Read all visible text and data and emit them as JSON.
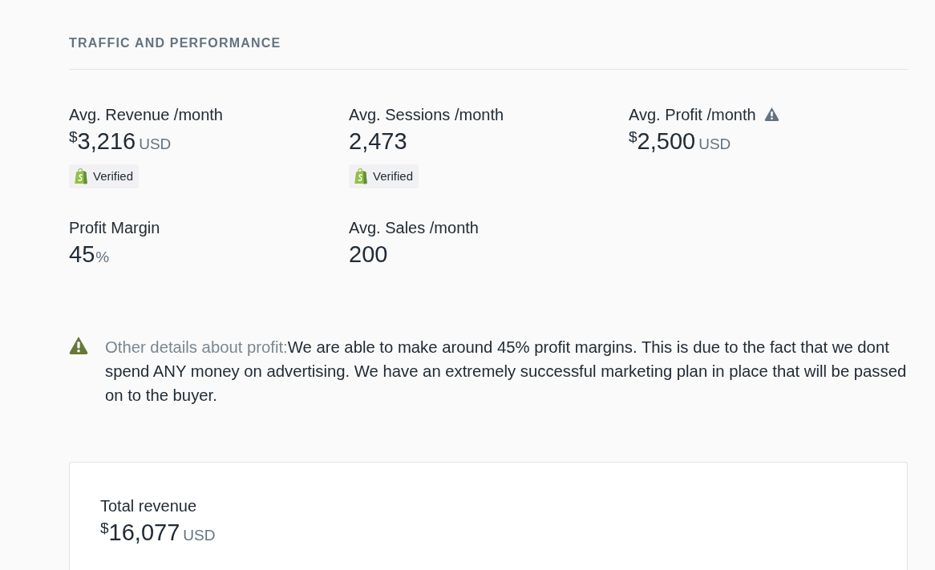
{
  "section_title": "TRAFFIC AND PERFORMANCE",
  "metrics": [
    {
      "label": "Avg. Revenue /month",
      "warning": false,
      "currency": "$",
      "value": "3,216",
      "unit": "USD",
      "badge": "Verified"
    },
    {
      "label": "Avg. Sessions /month",
      "warning": false,
      "value": "2,473",
      "badge": "Verified"
    },
    {
      "label": "Avg. Profit /month",
      "warning": true,
      "currency": "$",
      "value": "2,500",
      "unit": "USD"
    },
    {
      "label": "Profit Margin",
      "warning": false,
      "value": "45",
      "unit": "%"
    },
    {
      "label": "Avg. Sales /month",
      "warning": false,
      "value": "200"
    }
  ],
  "note": {
    "label": "Other details about profit:",
    "text": "We are able to make around 45% profit margins. This is due to the fact that we dont spend ANY money on advertising. We have an extremely successful marketing plan in place that will be passed on to the buyer."
  },
  "total_card": {
    "label": "Total revenue",
    "currency": "$",
    "value": "16,077",
    "unit": "USD"
  }
}
